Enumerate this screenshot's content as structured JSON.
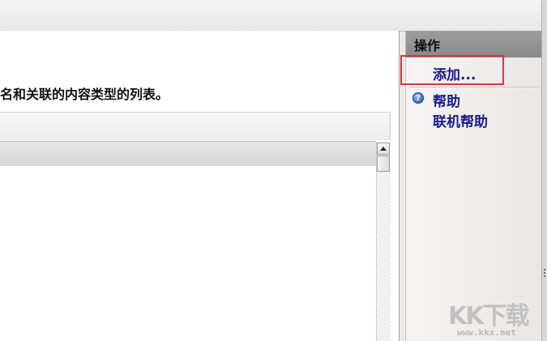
{
  "main": {
    "description": "名和关联的内容类型的列表。"
  },
  "actions_panel": {
    "title": "操作",
    "add_label": "添加...",
    "help_label": "帮助",
    "online_help_label": "联机帮助",
    "help_icon_glyph": "?"
  },
  "watermark": {
    "logo_text": "KK下载",
    "url": "www.kkx.net"
  }
}
